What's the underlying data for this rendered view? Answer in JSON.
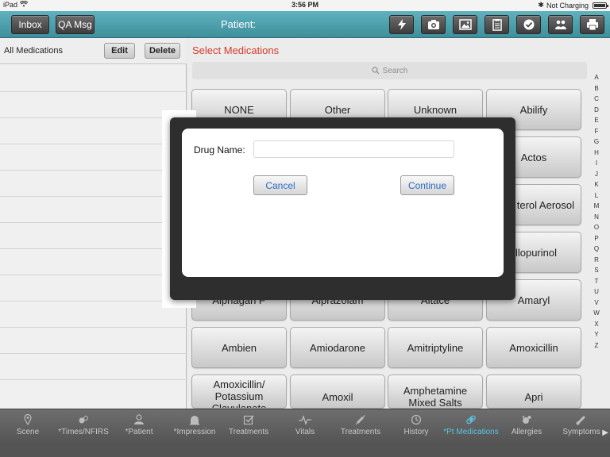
{
  "status_bar": {
    "device": "iPad",
    "time": "3:56 PM",
    "charging": "Not Charging"
  },
  "toolbar": {
    "inbox_label": "Inbox",
    "qa_label": "QA Msg",
    "patient_label": "Patient:"
  },
  "toolbar_icons": [
    "lightning-icon",
    "camera-icon",
    "image-icon",
    "clipboard-icon",
    "checkmark-icon",
    "people-icon",
    "printer-icon"
  ],
  "left_panel": {
    "title": "All Medications",
    "edit_label": "Edit",
    "delete_label": "Delete"
  },
  "right_panel": {
    "title": "Select Medications",
    "search_placeholder": "Search"
  },
  "alphabet": [
    "A",
    "B",
    "C",
    "D",
    "E",
    "F",
    "G",
    "H",
    "I",
    "J",
    "K",
    "L",
    "M",
    "N",
    "O",
    "P",
    "Q",
    "R",
    "S",
    "T",
    "U",
    "V",
    "W",
    "X",
    "Y",
    "Z"
  ],
  "medications": [
    "NONE",
    "Other",
    "Unknown",
    "Abilify",
    "Actos",
    "terol Aerosol",
    "llopurinol",
    "Alphagan P",
    "Alprazolam",
    "Altace",
    "Amaryl",
    "Ambien",
    "Amiodarone",
    "Amitriptyline",
    "Amoxicillin",
    "Amoxicillin/\nPotassium\nClavulanate",
    "Amoxil",
    "Amphetamine\nMixed Salts",
    "Apri"
  ],
  "bottom_tabs": [
    {
      "label": "Scene",
      "icon": "map-pin-icon"
    },
    {
      "label": "*Times/NFIRS",
      "icon": "times-icon"
    },
    {
      "label": "*Patient",
      "icon": "patient-icon"
    },
    {
      "label": "*Impression",
      "icon": "siren-icon"
    },
    {
      "label": "Treatments",
      "icon": "checkbox-icon"
    },
    {
      "label": "Vitals",
      "icon": "pulse-icon"
    },
    {
      "label": "Treatments",
      "icon": "syringe-icon"
    },
    {
      "label": "History",
      "icon": "clock-icon"
    },
    {
      "label": "*Pt Medications",
      "icon": "pill-icon",
      "active": true
    },
    {
      "label": "Allergies",
      "icon": "allergy-icon"
    },
    {
      "label": "Symptoms",
      "icon": "thermometer-icon"
    }
  ],
  "dialog": {
    "drug_name_label": "Drug Name:",
    "drug_name_value": "",
    "cancel_label": "Cancel",
    "continue_label": "Continue"
  },
  "colors": {
    "toolbar_teal": "#4fa3b0",
    "title_red": "#d33a2a",
    "active_tab_blue": "#59c3e3",
    "dialog_button_text": "#2a6cc4"
  }
}
